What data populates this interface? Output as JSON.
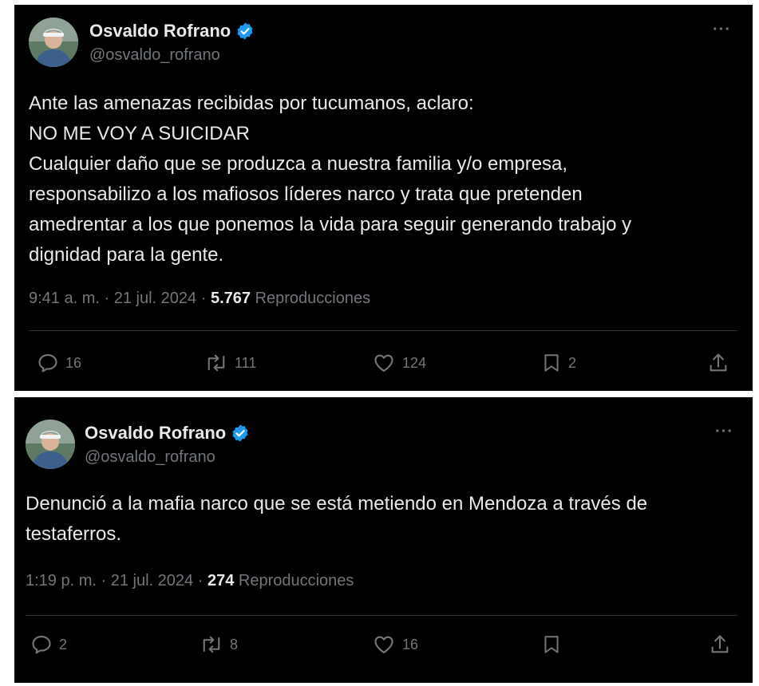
{
  "tweets": [
    {
      "author": {
        "display_name": "Osvaldo Rofrano",
        "handle": "@osvaldo_rofrano",
        "verified_icon": "verified-badge-icon"
      },
      "text_lines": [
        "Ante las amenazas recibidas por tucumanos, aclaro:",
        "NO ME VOY A SUICIDAR",
        "Cualquier daño que se produzca a nuestra familia y/o empresa,",
        "responsabilizo a los mafiosos líderes narco y trata que pretenden",
        "amedrentar a los que ponemos la vida para seguir generando trabajo y",
        "dignidad para la gente."
      ],
      "meta": {
        "time": "9:41 a. m.",
        "separator": "·",
        "date": "21 jul. 2024",
        "views": "5.767",
        "views_label": "Reproducciones"
      },
      "actions": {
        "replies": "16",
        "retweets": "111",
        "likes": "124",
        "bookmarks": "2"
      },
      "more_label": "···"
    },
    {
      "author": {
        "display_name": "Osvaldo Rofrano",
        "handle": "@osvaldo_rofrano",
        "verified_icon": "verified-badge-icon"
      },
      "text_lines": [
        "Denunció a la mafia narco que se está metiendo en Mendoza a través de",
        "testaferros."
      ],
      "meta": {
        "time": "1:19 p. m.",
        "separator": "·",
        "date": "21 jul. 2024",
        "views": "274",
        "views_label": "Reproducciones"
      },
      "actions": {
        "replies": "2",
        "retweets": "8",
        "likes": "16",
        "bookmarks": ""
      },
      "more_label": "···"
    }
  ],
  "colors": {
    "background": "#000000",
    "text": "#e7e9ea",
    "muted": "#71767b",
    "verified": "#1d9bf0",
    "divider": "#2f3336"
  }
}
